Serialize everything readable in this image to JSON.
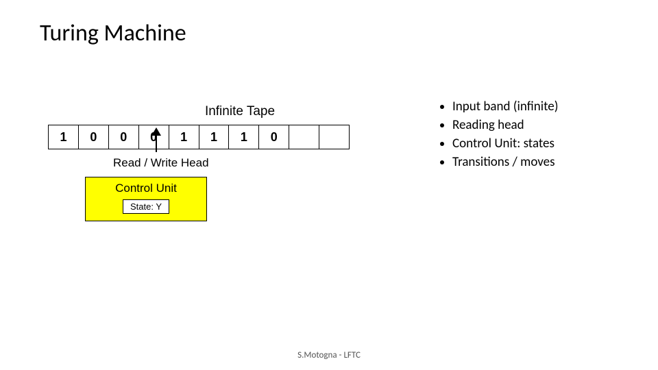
{
  "title": "Turing Machine",
  "diagram": {
    "tape_label": "Infinite Tape",
    "cells": [
      "1",
      "0",
      "0",
      "0",
      "1",
      "1",
      "1",
      "0",
      "",
      ""
    ],
    "rw_head_label": "Read / Write Head",
    "control_unit_label": "Control Unit",
    "state_label": "State: Y"
  },
  "bullets": [
    "Input band (infinite)",
    "Reading head",
    "Control Unit: states",
    "Transitions / moves"
  ],
  "footer": "S.Motogna - LFTC"
}
